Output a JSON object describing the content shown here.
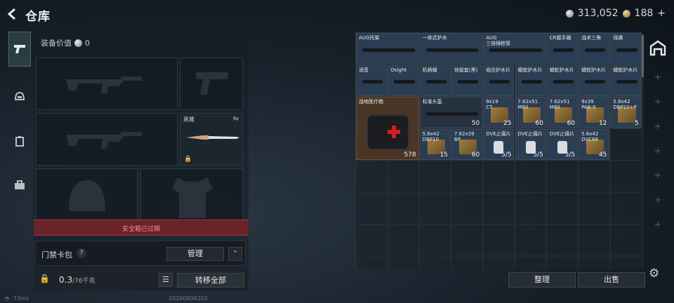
{
  "header": {
    "title": "仓库",
    "currency_silver": "313,052",
    "currency_bronze": "188",
    "add": "+"
  },
  "nav": [
    "weapon-icon",
    "armor-icon",
    "rig-icon",
    "backpack-icon"
  ],
  "loadout": {
    "equipment_value_label": "装备价值",
    "equipment_value": "0",
    "melee_name": "黑鹰",
    "expired_notice": "安全箱已过期",
    "card_pack_label": "门禁卡包",
    "help": "?",
    "manage_label": "管理",
    "collapse": "⌃",
    "weight": "0.3",
    "weight_max": "/76千克",
    "move_all_label": "转移全部"
  },
  "stash": {
    "items": [
      {
        "name": "AUG托架",
        "qty": ""
      },
      {
        "name": "一体式护木",
        "qty": ""
      },
      {
        "name": "AUG\n三倍镜枪管",
        "qty": ""
      },
      {
        "name": "CR握手器",
        "qty": ""
      },
      {
        "name": "战术三角",
        "qty": ""
      },
      {
        "name": "侵袭",
        "qty": ""
      },
      {
        "name": "消音",
        "qty": ""
      },
      {
        "name": "Osight",
        "qty": ""
      },
      {
        "name": "机柄帽",
        "qty": ""
      },
      {
        "name": "快拔套(黑)",
        "qty": ""
      },
      {
        "name": "组合护木片",
        "qty": ""
      },
      {
        "name": "蟒蛇护木片",
        "qty": ""
      },
      {
        "name": "蟒蛇护木片",
        "qty": ""
      },
      {
        "name": "蟒蛇护木片",
        "qty": ""
      },
      {
        "name": "蟒蛇护木片",
        "qty": ""
      },
      {
        "name": "战地医疗箱",
        "qty": "578"
      },
      {
        "name": "标准头盔",
        "qty": "50"
      },
      {
        "name": "9x19\nCT",
        "qty": "25"
      },
      {
        "name": "7.62x51\nM80",
        "qty": "60"
      },
      {
        "name": "7.62x51\nM80",
        "qty": "60"
      },
      {
        "name": "9x39\nPAB-9",
        "qty": "12"
      },
      {
        "name": "5.8x42\nDBP10+P",
        "qty": "5"
      },
      {
        "name": "5.8x42\nDBP10",
        "qty": "15"
      },
      {
        "name": "7.62x39\nBP",
        "qty": "60"
      },
      {
        "name": "DVE止痛片",
        "qty": "5/5"
      },
      {
        "name": "DVE止痛片",
        "qty": "5/5"
      },
      {
        "name": "DVE止痛片",
        "qty": "3/5"
      },
      {
        "name": "5.8x42\nDVC88",
        "qty": "45"
      }
    ],
    "sort_label": "整理",
    "sell_label": "出售"
  },
  "status": {
    "ping": "73ms",
    "build": "20260808102"
  },
  "colors": {
    "accent": "#4a6a6c",
    "expired": "#6a2328",
    "item_blue": "#2b3d52"
  }
}
